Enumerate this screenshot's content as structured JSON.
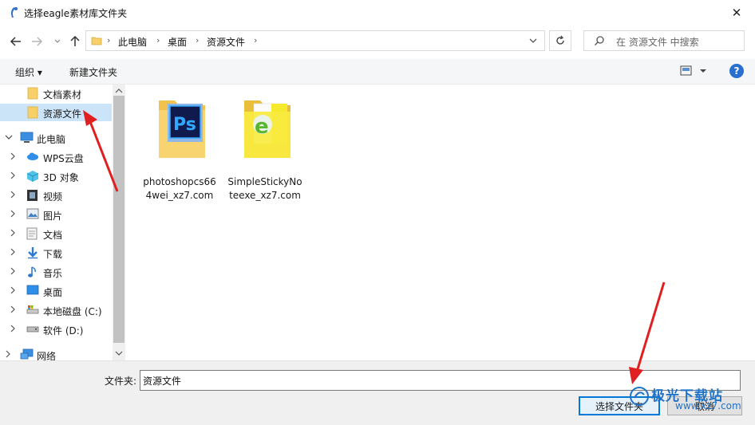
{
  "window": {
    "title": "选择eagle素材库文件夹",
    "close_glyph": "✕"
  },
  "address": {
    "breadcrumbs": [
      "此电脑",
      "桌面",
      "资源文件"
    ],
    "search_placeholder": "在 资源文件 中搜索"
  },
  "toolbar": {
    "organize": "组织 ▾",
    "new_folder": "新建文件夹",
    "help": "?"
  },
  "nav": {
    "items": [
      {
        "label": "文档素材",
        "icon": "folder-icon"
      },
      {
        "label": "资源文件",
        "icon": "folder-icon",
        "selected": true
      },
      {
        "label": "此电脑",
        "icon": "pc-icon",
        "expanded": true
      },
      {
        "label": "WPS云盘",
        "icon": "cloud-icon"
      },
      {
        "label": "3D 对象",
        "icon": "cube-icon"
      },
      {
        "label": "视频",
        "icon": "video-icon"
      },
      {
        "label": "图片",
        "icon": "picture-icon"
      },
      {
        "label": "文档",
        "icon": "document-icon"
      },
      {
        "label": "下载",
        "icon": "download-icon"
      },
      {
        "label": "音乐",
        "icon": "music-icon"
      },
      {
        "label": "桌面",
        "icon": "desktop-icon"
      },
      {
        "label": "本地磁盘 (C:)",
        "icon": "disk-icon"
      },
      {
        "label": "软件 (D:)",
        "icon": "drive-icon"
      },
      {
        "label": "网络",
        "icon": "network-icon"
      }
    ]
  },
  "files": [
    {
      "name_line1": "photoshopcs66",
      "name_line2": "4wei_xz7.com",
      "badge": "Ps",
      "icon": "photoshop-folder-icon"
    },
    {
      "name_line1": "SimpleStickyNo",
      "name_line2": "teexe_xz7.com",
      "badge": "e",
      "icon": "sticky-folder-icon"
    }
  ],
  "bottom": {
    "folder_label": "文件夹:",
    "folder_value": "资源文件",
    "select_button": "选择文件夹",
    "cancel_button": "取消"
  },
  "watermark": {
    "line1": "极光下载站",
    "line2": "www.xz7.com"
  },
  "colors": {
    "selection": "#cce4f7",
    "accent": "#0078d7",
    "arrow": "#e02020",
    "folder": "#f7d06a"
  }
}
